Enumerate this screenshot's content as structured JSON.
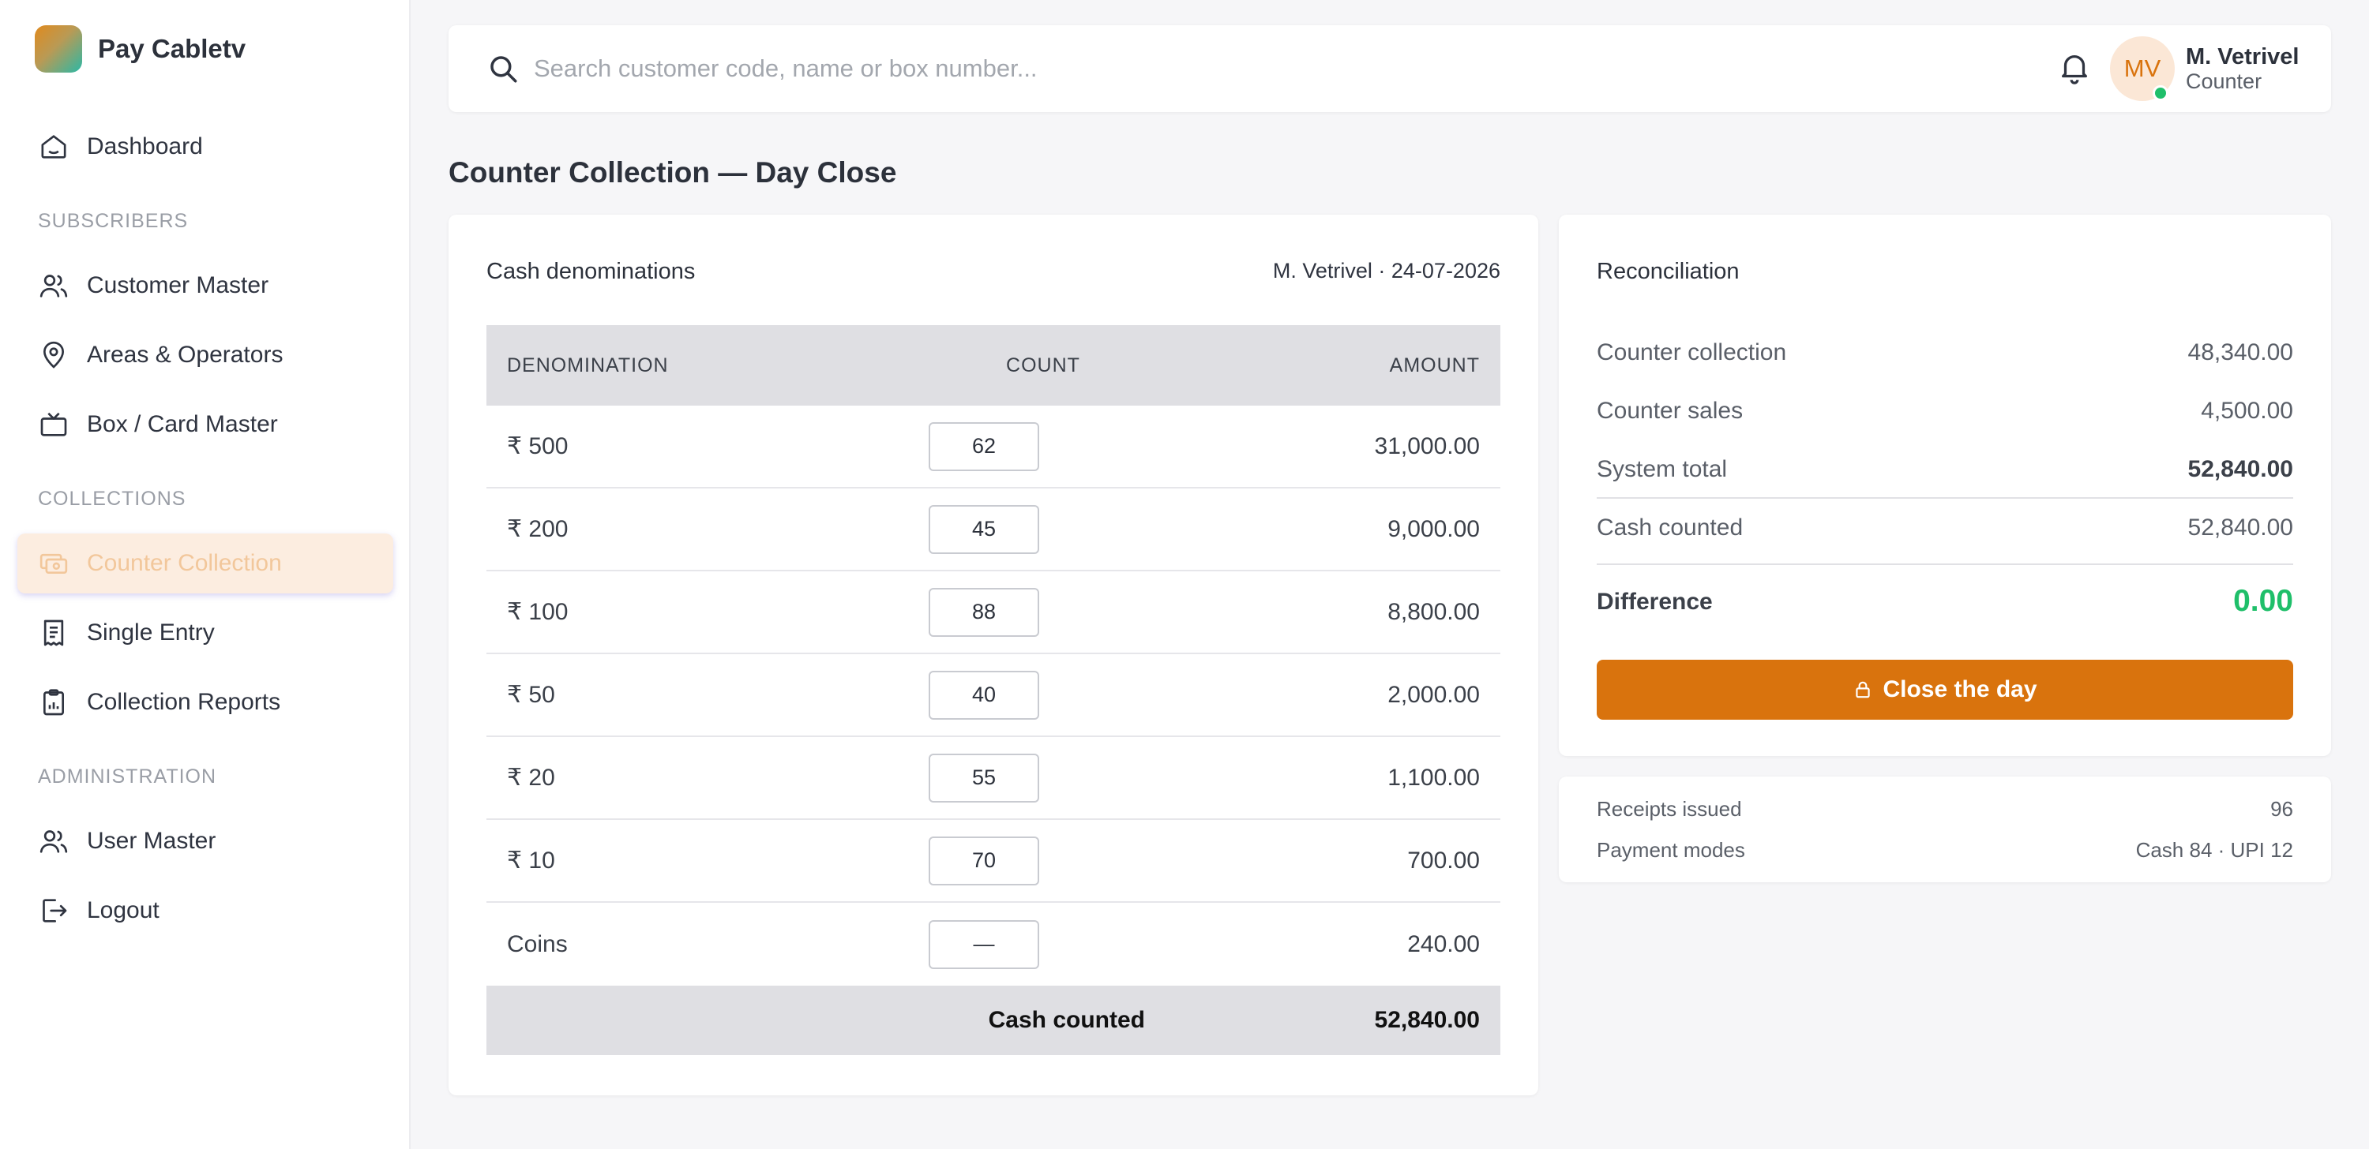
{
  "app": {
    "name": "Pay Cabletv"
  },
  "sidebar": {
    "items": [
      {
        "label": "Dashboard",
        "icon": "home-icon"
      },
      {
        "label": "Customer Master",
        "icon": "users-icon"
      },
      {
        "label": "Areas & Operators",
        "icon": "map-pin-icon"
      },
      {
        "label": "Box / Card Master",
        "icon": "tv-icon"
      },
      {
        "label": "Counter Collection",
        "icon": "cash-icon",
        "active": true
      },
      {
        "label": "Single Entry",
        "icon": "receipt-icon"
      },
      {
        "label": "Collection Reports",
        "icon": "clipboard-icon"
      },
      {
        "label": "User Master",
        "icon": "users-icon"
      },
      {
        "label": "Logout",
        "icon": "logout-icon"
      }
    ],
    "sections": [
      "SUBSCRIBERS",
      "COLLECTIONS",
      "ADMINISTRATION"
    ]
  },
  "search": {
    "placeholder": "Search customer code, name or box number..."
  },
  "user": {
    "initials": "MV",
    "name": "M. Vetrivel",
    "role": "Counter",
    "status_color": "#1fbf6a"
  },
  "page": {
    "title": "Counter Collection — Day Close"
  },
  "denominations": {
    "title": "Cash denominations",
    "meta": "M. Vetrivel · 24-07-2026",
    "headers": [
      "DENOMINATION",
      "COUNT",
      "AMOUNT"
    ],
    "rows": [
      {
        "label": "₹ 500",
        "count": "62",
        "amount": "31,000.00"
      },
      {
        "label": "₹ 200",
        "count": "45",
        "amount": "9,000.00"
      },
      {
        "label": "₹ 100",
        "count": "88",
        "amount": "8,800.00"
      },
      {
        "label": "₹ 50",
        "count": "40",
        "amount": "2,000.00"
      },
      {
        "label": "₹ 20",
        "count": "55",
        "amount": "1,100.00"
      },
      {
        "label": "₹ 10",
        "count": "70",
        "amount": "700.00"
      },
      {
        "label": "Coins",
        "count": "—",
        "amount": "240.00"
      }
    ],
    "footer": {
      "label": "Cash counted",
      "value": "52,840.00"
    }
  },
  "reconciliation": {
    "title": "Reconciliation",
    "rows": [
      {
        "label": "Counter collection",
        "value": "48,340.00"
      },
      {
        "label": "Counter sales",
        "value": "4,500.00"
      },
      {
        "label": "System total",
        "value": "52,840.00"
      },
      {
        "label": "Cash counted",
        "value": "52,840.00"
      }
    ],
    "difference_label": "Difference",
    "difference_value": "0.00",
    "difference_color": "#1fbf6a",
    "button_label": "Close the day",
    "button_color": "#d9730d"
  },
  "summary": {
    "rows": [
      {
        "label": "Receipts issued",
        "value": "96"
      },
      {
        "label": "Payment modes",
        "value": "Cash 84 · UPI 12"
      }
    ]
  }
}
